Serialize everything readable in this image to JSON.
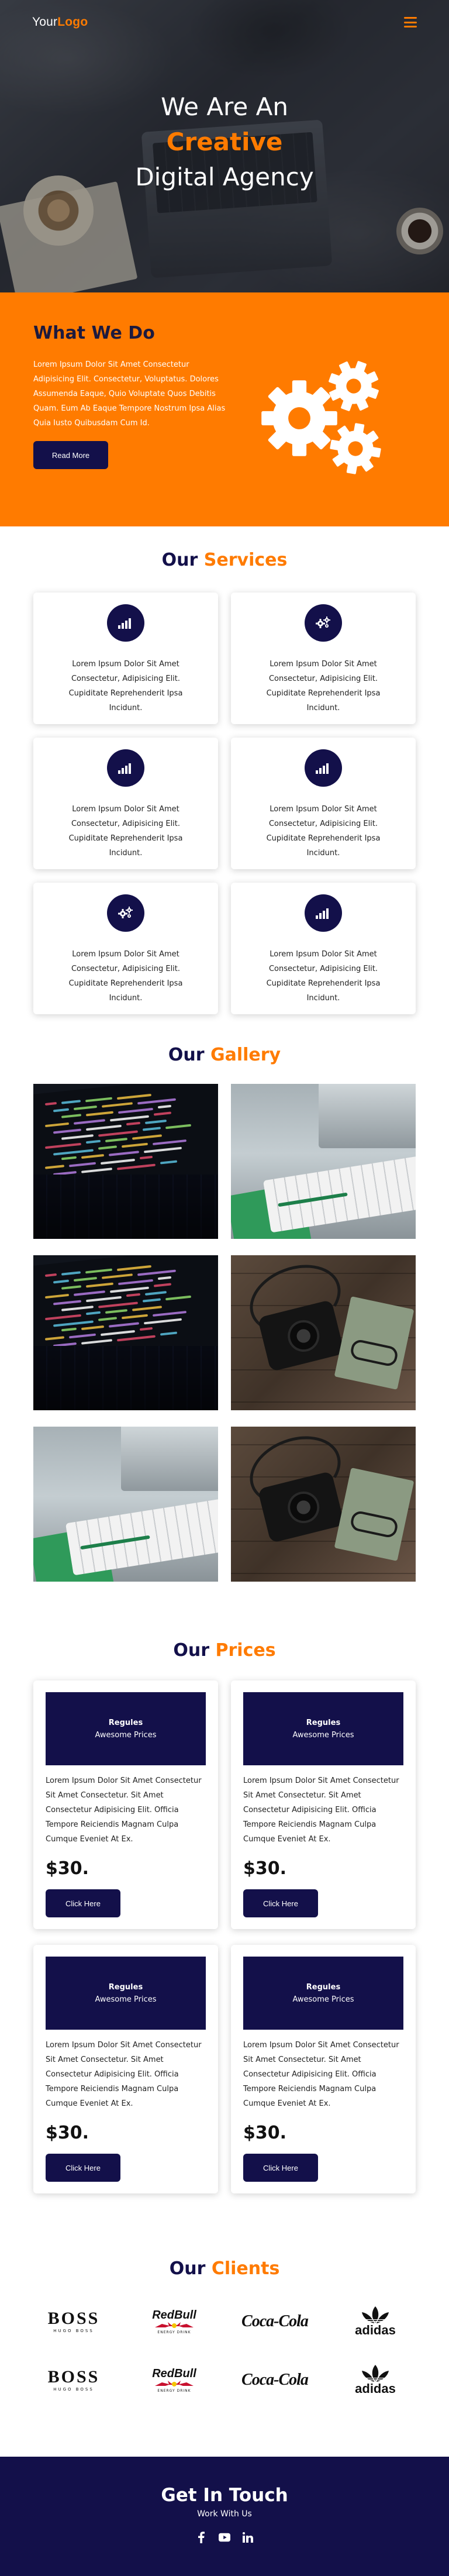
{
  "header": {
    "logo_prefix": "Your",
    "logo_brand": "Logo",
    "menu_icon": "hamburger-icon"
  },
  "hero": {
    "line1": "We Are An",
    "line2": "Creative",
    "line3": "Digital Agency"
  },
  "what_we_do": {
    "title": "What We Do",
    "text": "Lorem Ipsum Dolor Sit Amet Consectetur Adipisicing Elit. Consectetur, Voluptatus. Dolores Assumenda Eaque, Quio Voluptate Quos Debitis Quam. Eum Ab Eaque Tempore Nostrum Ipsa Alias Quia Iusto Quibusdam Cum Id.",
    "button": "Read More",
    "illustration": "gears-icon"
  },
  "services": {
    "title_a": "Our",
    "title_b": "Services",
    "items": [
      {
        "icon": "signal-bars-icon",
        "text": "Lorem Ipsum Dolor Sit Amet Consectetur, Adipisicing Elit. Cupiditate Reprehenderit Ipsa Incidunt."
      },
      {
        "icon": "gears-icon",
        "text": "Lorem Ipsum Dolor Sit Amet Consectetur, Adipisicing Elit. Cupiditate Reprehenderit Ipsa Incidunt."
      },
      {
        "icon": "signal-bars-icon",
        "text": "Lorem Ipsum Dolor Sit Amet Consectetur, Adipisicing Elit. Cupiditate Reprehenderit Ipsa Incidunt."
      },
      {
        "icon": "signal-bars-icon",
        "text": "Lorem Ipsum Dolor Sit Amet Consectetur, Adipisicing Elit. Cupiditate Reprehenderit Ipsa Incidunt."
      },
      {
        "icon": "gears-icon",
        "text": "Lorem Ipsum Dolor Sit Amet Consectetur, Adipisicing Elit. Cupiditate Reprehenderit Ipsa Incidunt."
      },
      {
        "icon": "signal-bars-icon",
        "text": "Lorem Ipsum Dolor Sit Amet Consectetur, Adipisicing Elit. Cupiditate Reprehenderit Ipsa Incidunt."
      }
    ]
  },
  "gallery": {
    "title_a": "Our",
    "title_b": "Gallery",
    "images": [
      "code-laptop-photo",
      "keyboard-desk-photo",
      "code-laptop-photo",
      "camera-notebook-photo",
      "keyboard-desk-photo",
      "camera-notebook-photo"
    ]
  },
  "prices": {
    "title_a": "Our",
    "title_b": "Prices",
    "plans": [
      {
        "head1": "Regules",
        "head2": "Awesome Prices",
        "text": "Lorem Ipsum Dolor Sit Amet Consectetur Sit Amet Consectetur. Sit Amet Consectetur Adipisicing Elit. Officia Tempore Reiciendis Magnam Culpa Cumque Eveniet At Ex.",
        "price": "$30.",
        "button": "Click Here"
      },
      {
        "head1": "Regules",
        "head2": "Awesome Prices",
        "text": "Lorem Ipsum Dolor Sit Amet Consectetur Sit Amet Consectetur. Sit Amet Consectetur Adipisicing Elit. Officia Tempore Reiciendis Magnam Culpa Cumque Eveniet At Ex.",
        "price": "$30.",
        "button": "Click Here"
      },
      {
        "head1": "Regules",
        "head2": "Awesome Prices",
        "text": "Lorem Ipsum Dolor Sit Amet Consectetur Sit Amet Consectetur. Sit Amet Consectetur Adipisicing Elit. Officia Tempore Reiciendis Magnam Culpa Cumque Eveniet At Ex.",
        "price": "$30.",
        "button": "Click Here"
      },
      {
        "head1": "Regules",
        "head2": "Awesome Prices",
        "text": "Lorem Ipsum Dolor Sit Amet Consectetur Sit Amet Consectetur. Sit Amet Consectetur Adipisicing Elit. Officia Tempore Reiciendis Magnam Culpa Cumque Eveniet At Ex.",
        "price": "$30.",
        "button": "Click Here"
      }
    ]
  },
  "clients": {
    "title_a": "Our",
    "title_b": "Clients",
    "logos": [
      {
        "name": "BOSS",
        "sub": "HUGO BOSS"
      },
      {
        "name": "RedBull",
        "sub": "ENERGY DRINK"
      },
      {
        "name": "Coca-Cola",
        "sub": ""
      },
      {
        "name": "adidas",
        "sub": ""
      }
    ]
  },
  "footer": {
    "title": "Get In Touch",
    "subtitle": "Work With Us",
    "social_icons": [
      "facebook-icon",
      "youtube-icon",
      "linkedin-icon"
    ]
  },
  "colors": {
    "accent": "#ff7b00",
    "navy": "#13104a"
  }
}
